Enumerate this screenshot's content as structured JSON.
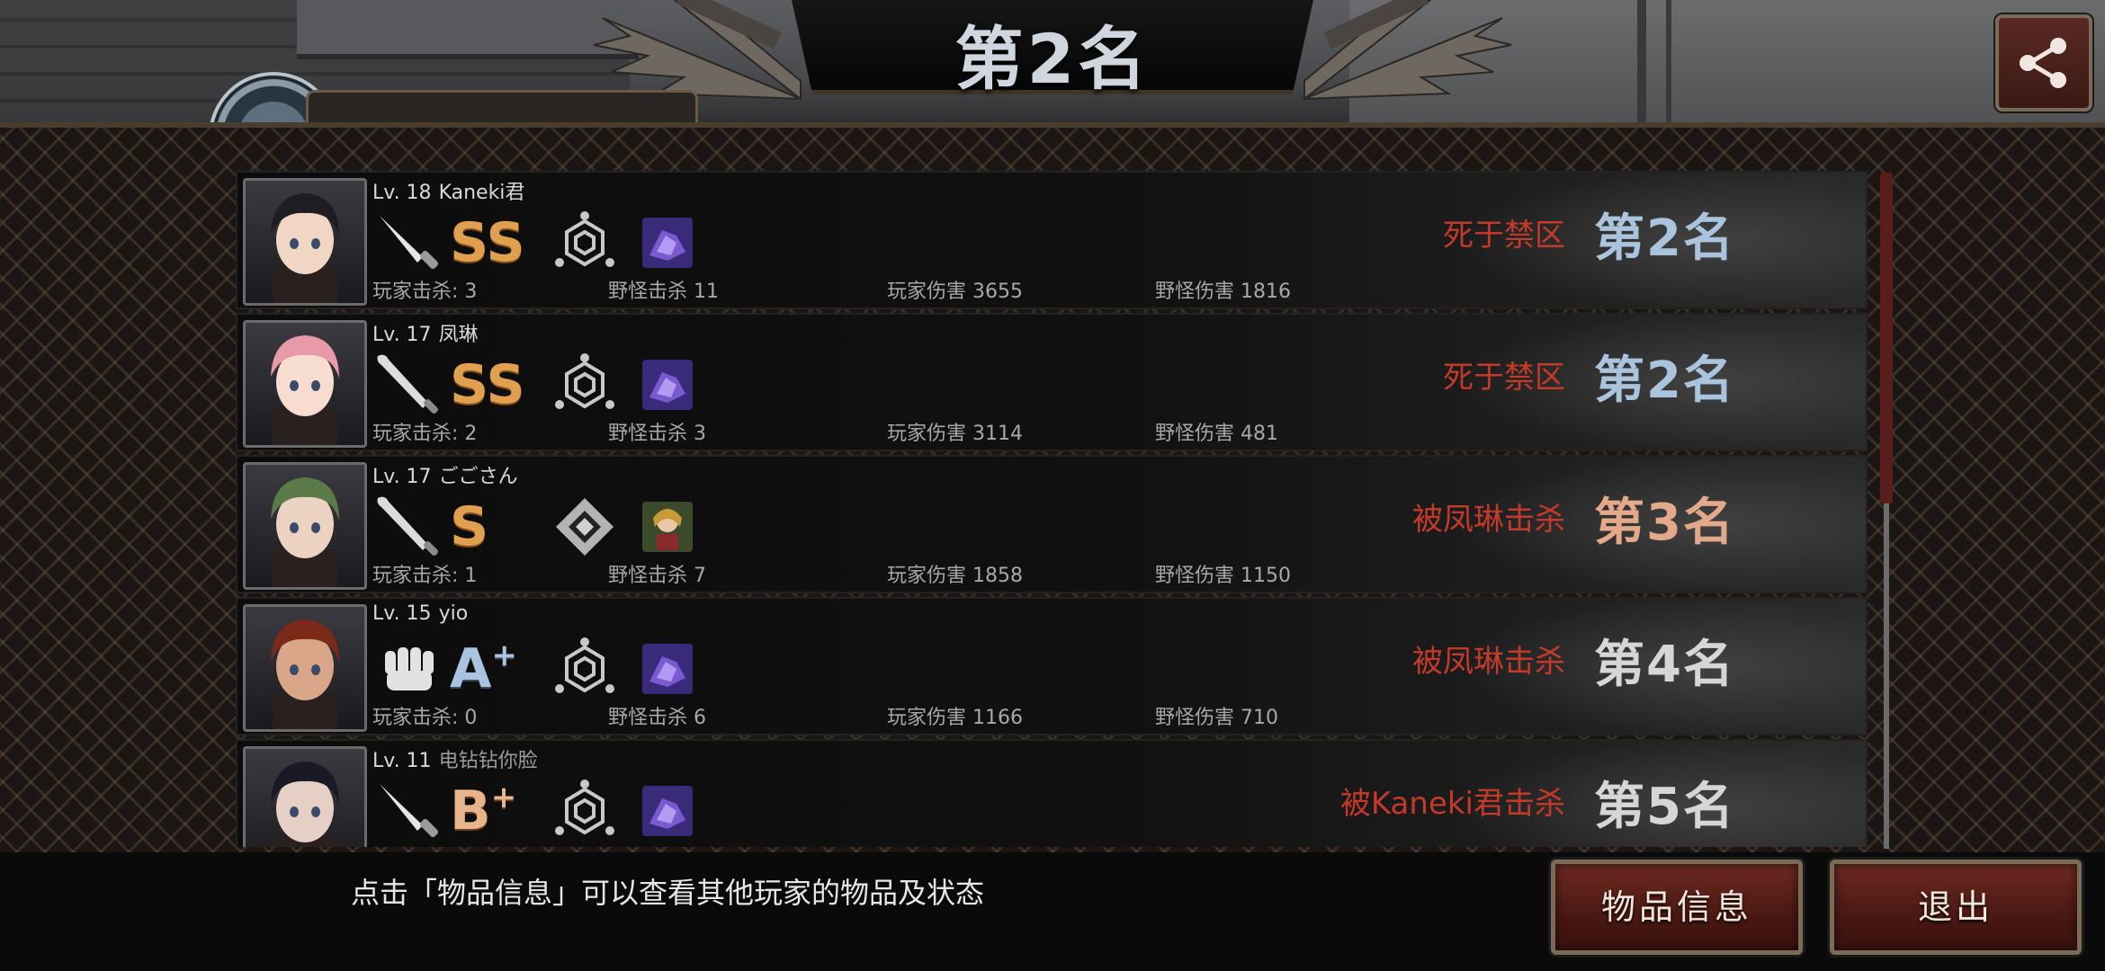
{
  "header": {
    "title": "第2名",
    "player_name_partial": "Kaneki君"
  },
  "players": [
    {
      "level": "Lv. 18",
      "name": "Kaneki君",
      "name_grey": false,
      "weapon": "knife-icon",
      "grade_main": "SS",
      "grade_sup": "",
      "grade_color": "gold",
      "skill_icon": "hexagon-emblem-icon",
      "item_icon": "purple-item-icon",
      "stats": {
        "player_kills": "玩家击杀: 3",
        "monster_kills": "野怪击杀 11",
        "player_damage": "玩家伤害 3655",
        "monster_damage": "野怪伤害 1816"
      },
      "death": "死于禁区",
      "rank": "第2名",
      "rank_color": "blue",
      "hair": "#1d1d22",
      "skin": "#f1d6c4"
    },
    {
      "level": "Lv. 17",
      "name": "凤琳",
      "name_grey": false,
      "weapon": "bat-icon",
      "grade_main": "SS",
      "grade_sup": "",
      "grade_color": "gold",
      "skill_icon": "hexagon-emblem-icon",
      "item_icon": "purple-item-icon",
      "stats": {
        "player_kills": "玩家击杀: 2",
        "monster_kills": "野怪击杀 3",
        "player_damage": "玩家伤害 3114",
        "monster_damage": "野怪伤害 481"
      },
      "death": "死于禁区",
      "rank": "第2名",
      "rank_color": "blue",
      "hair": "#e89aa8",
      "skin": "#f6ddd0"
    },
    {
      "level": "Lv. 17",
      "name": "ごごさん",
      "name_grey": false,
      "weapon": "bat-icon",
      "grade_main": "S",
      "grade_sup": "",
      "grade_color": "gold",
      "skill_icon": "diamond-emblem-icon",
      "item_icon": "character-item-icon",
      "stats": {
        "player_kills": "玩家击杀: 1",
        "monster_kills": "野怪击杀 7",
        "player_damage": "玩家伤害 1858",
        "monster_damage": "野怪伤害 1150"
      },
      "death": "被凤琳击杀",
      "rank": "第3名",
      "rank_color": "orange",
      "hair": "#5a7a4a",
      "skin": "#ecd2c0"
    },
    {
      "level": "Lv. 15",
      "name": "yio",
      "name_grey": false,
      "weapon": "fist-icon",
      "grade_main": "A",
      "grade_sup": "+",
      "grade_color": "silver",
      "skill_icon": "hexagon-emblem-icon",
      "item_icon": "purple-item-icon",
      "stats": {
        "player_kills": "玩家击杀: 0",
        "monster_kills": "野怪击杀 6",
        "player_damage": "玩家伤害 1166",
        "monster_damage": "野怪伤害 710"
      },
      "death": "被凤琳击杀",
      "rank": "第4名",
      "rank_color": "white",
      "hair": "#7a2a18",
      "skin": "#d9a68a"
    },
    {
      "level": "Lv. 11",
      "name": "电钻钻你脸",
      "name_grey": true,
      "weapon": "knife-icon",
      "grade_main": "B",
      "grade_sup": "+",
      "grade_color": "bronze",
      "skill_icon": "hexagon-emblem-icon",
      "item_icon": "purple-item-icon",
      "stats": {
        "player_kills": "",
        "monster_kills": "",
        "player_damage": "",
        "monster_damage": ""
      },
      "death": "被Kaneki君击杀",
      "rank": "第5名",
      "rank_color": "white",
      "hair": "#1a1a26",
      "skin": "#e6cfc4"
    }
  ],
  "footer": {
    "hint": "点击「物品信息」可以查看其他玩家的物品及状态",
    "item_info_button": "物品信息",
    "exit_button": "退出"
  }
}
